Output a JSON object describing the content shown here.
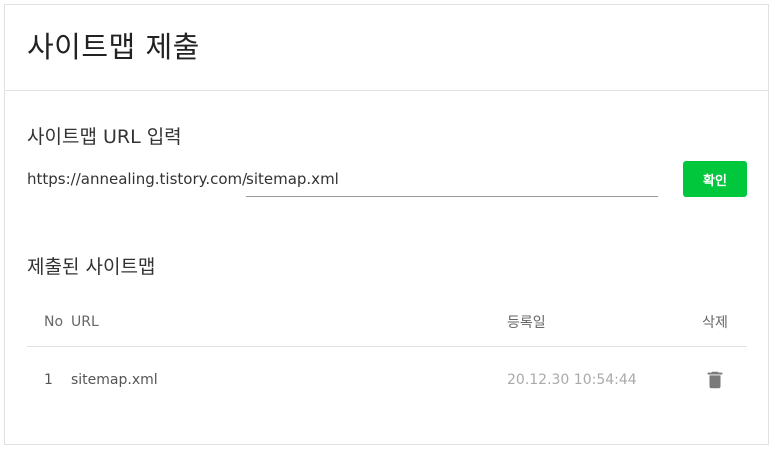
{
  "header": {
    "title": "사이트맵 제출"
  },
  "url_section": {
    "title": "사이트맵 URL 입력",
    "prefix": "https://annealing.tistory.com/",
    "input_value": "sitemap.xml",
    "confirm_label": "확인",
    "confirm_color": "#00c73c"
  },
  "submitted_section": {
    "title": "제출된 사이트맵",
    "columns": {
      "no": "No",
      "url": "URL",
      "registered": "등록일",
      "delete": "삭제"
    },
    "rows": [
      {
        "no": "1",
        "url": "sitemap.xml",
        "registered": "20.12.30 10:54:44",
        "delete_icon": "trash-icon"
      }
    ]
  }
}
